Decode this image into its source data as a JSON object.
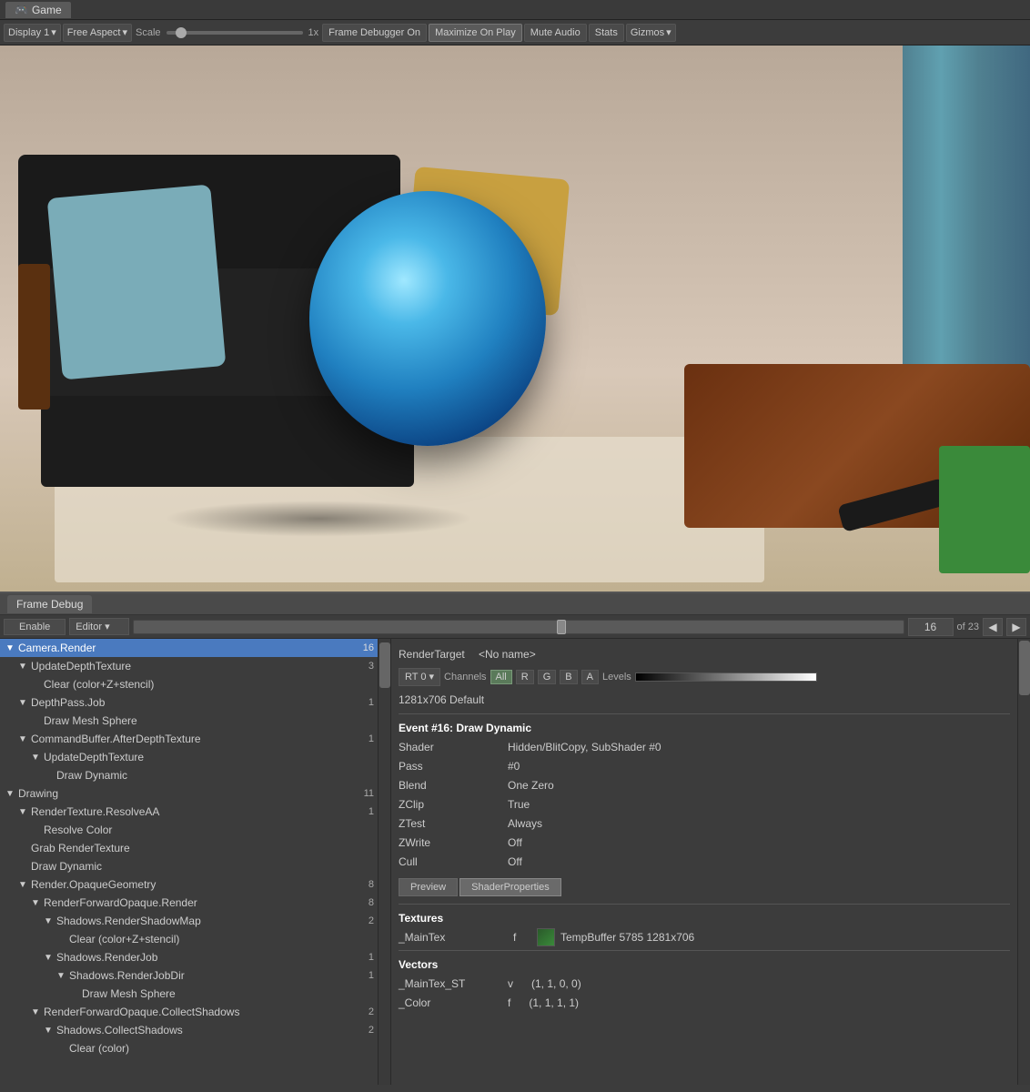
{
  "gameWindow": {
    "title": "Game",
    "display": "Display 1",
    "aspect": "Free Aspect",
    "scaleLabel": "Scale",
    "scaleValue": "1x",
    "frameDebugger": "Frame Debugger On",
    "maximizeOnPlay": "Maximize On Play",
    "muteAudio": "Mute Audio",
    "stats": "Stats",
    "gizmos": "Gizmos"
  },
  "frameDebug": {
    "tabLabel": "Frame Debug",
    "enableBtn": "Enable",
    "editorOption": "Editor",
    "frameNum": "16",
    "ofTotal": "of 23",
    "prevArrow": "◀",
    "nextArrow": "▶"
  },
  "treeItems": [
    {
      "indent": 0,
      "arrow": "▼",
      "label": "Camera.Render",
      "count": "16",
      "selected": true
    },
    {
      "indent": 1,
      "arrow": "▼",
      "label": "UpdateDepthTexture",
      "count": "3",
      "selected": false
    },
    {
      "indent": 2,
      "arrow": "",
      "label": "Clear (color+Z+stencil)",
      "count": "",
      "selected": false
    },
    {
      "indent": 1,
      "arrow": "▼",
      "label": "DepthPass.Job",
      "count": "1",
      "selected": false
    },
    {
      "indent": 2,
      "arrow": "",
      "label": "Draw Mesh Sphere",
      "count": "",
      "selected": false
    },
    {
      "indent": 1,
      "arrow": "▼",
      "label": "CommandBuffer.AfterDepthTexture",
      "count": "1",
      "selected": false
    },
    {
      "indent": 2,
      "arrow": "▼",
      "label": "UpdateDepthTexture",
      "count": "",
      "selected": false
    },
    {
      "indent": 3,
      "arrow": "",
      "label": "Draw Dynamic",
      "count": "",
      "selected": false
    },
    {
      "indent": 0,
      "arrow": "▼",
      "label": "Drawing",
      "count": "11",
      "selected": false
    },
    {
      "indent": 1,
      "arrow": "▼",
      "label": "RenderTexture.ResolveAA",
      "count": "1",
      "selected": false
    },
    {
      "indent": 2,
      "arrow": "",
      "label": "Resolve Color",
      "count": "",
      "selected": false
    },
    {
      "indent": 1,
      "arrow": "",
      "label": "Grab RenderTexture",
      "count": "",
      "selected": false
    },
    {
      "indent": 1,
      "arrow": "",
      "label": "Draw Dynamic",
      "count": "",
      "selected": false
    },
    {
      "indent": 1,
      "arrow": "▼",
      "label": "Render.OpaqueGeometry",
      "count": "8",
      "selected": false
    },
    {
      "indent": 2,
      "arrow": "▼",
      "label": "RenderForwardOpaque.Render",
      "count": "8",
      "selected": false
    },
    {
      "indent": 3,
      "arrow": "▼",
      "label": "Shadows.RenderShadowMap",
      "count": "2",
      "selected": false
    },
    {
      "indent": 4,
      "arrow": "",
      "label": "Clear (color+Z+stencil)",
      "count": "",
      "selected": false
    },
    {
      "indent": 3,
      "arrow": "▼",
      "label": "Shadows.RenderJob",
      "count": "1",
      "selected": false
    },
    {
      "indent": 4,
      "arrow": "▼",
      "label": "Shadows.RenderJobDir",
      "count": "1",
      "selected": false
    },
    {
      "indent": 5,
      "arrow": "",
      "label": "Draw Mesh Sphere",
      "count": "",
      "selected": false
    },
    {
      "indent": 2,
      "arrow": "▼",
      "label": "RenderForwardOpaque.CollectShadows",
      "count": "2",
      "selected": false
    },
    {
      "indent": 3,
      "arrow": "▼",
      "label": "Shadows.CollectShadows",
      "count": "2",
      "selected": false
    },
    {
      "indent": 4,
      "arrow": "",
      "label": "Clear (color)",
      "count": "",
      "selected": false
    }
  ],
  "renderTarget": {
    "label": "RenderTarget",
    "value": "<No name>",
    "rtOption": "RT 0",
    "channelsLabel": "Channels",
    "channelAll": "All",
    "channelR": "R",
    "channelG": "G",
    "channelB": "B",
    "channelA": "A",
    "levelsLabel": "Levels",
    "resolution": "1281x706 Default"
  },
  "eventInfo": {
    "title": "Event #16: Draw Dynamic",
    "shaderLabel": "Shader",
    "shaderValue": "Hidden/BlitCopy, SubShader #0",
    "passLabel": "Pass",
    "passValue": "#0",
    "blendLabel": "Blend",
    "blendValue": "One Zero",
    "zclipLabel": "ZClip",
    "zclipValue": "True",
    "ztestLabel": "ZTest",
    "ztestValue": "Always",
    "zwriteLabel": "ZWrite",
    "zwriteValue": "Off",
    "cullLabel": "Cull",
    "cullValue": "Off"
  },
  "buttons": {
    "preview": "Preview",
    "shaderProperties": "ShaderProperties"
  },
  "textures": {
    "sectionLabel": "Textures",
    "mainTexLabel": "_MainTex",
    "mainTexType": "f",
    "mainTexValue": "TempBuffer 5785 1281x706"
  },
  "vectors": {
    "sectionLabel": "Vectors",
    "mainTexSTLabel": "_MainTex_ST",
    "mainTexSTType": "v",
    "mainTexSTValue": "(1, 1, 0, 0)",
    "colorLabel": "_Color",
    "colorType": "f",
    "colorValue": "(1, 1, 1, 1)"
  }
}
